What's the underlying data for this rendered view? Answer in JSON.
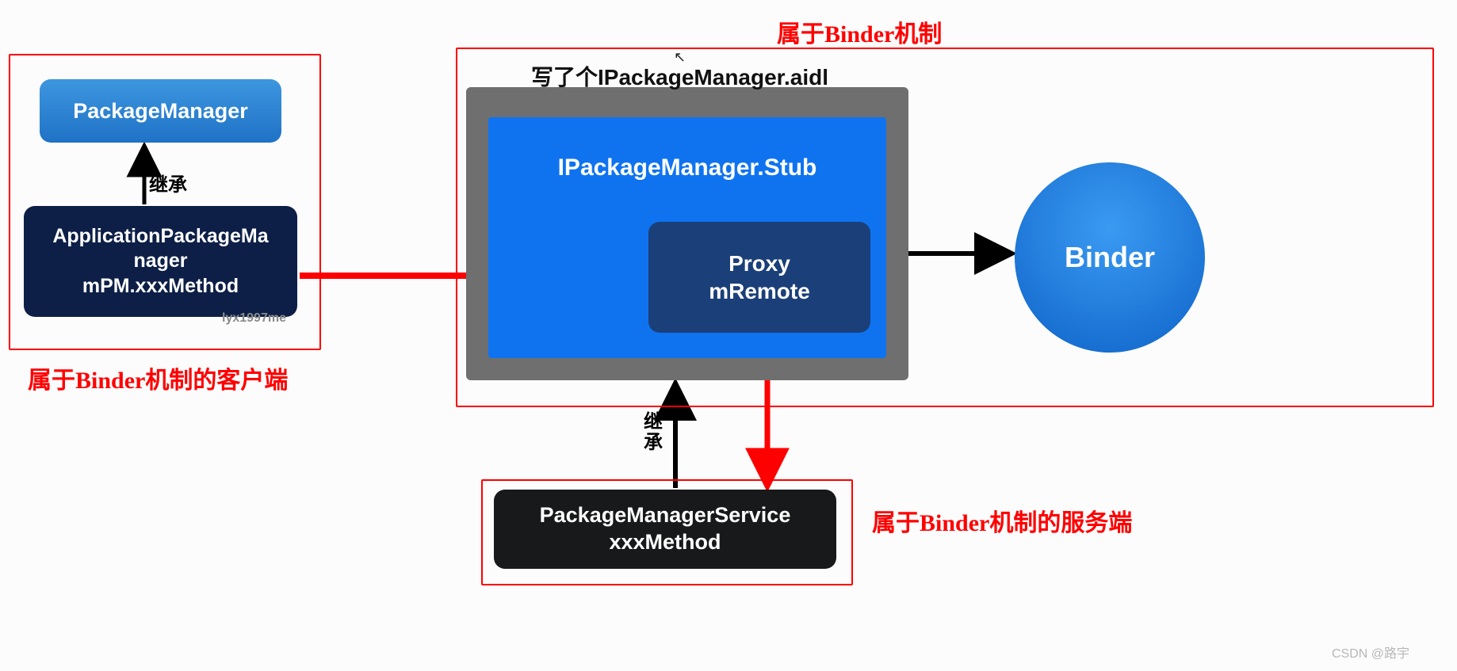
{
  "labels": {
    "binder_top": "属于Binder机制",
    "client": "属于Binder机制的客户端",
    "server": "属于Binder机制的服务端",
    "aidl_file": "写了个IPackageManager.aidl",
    "inherit1": "继承",
    "inherit2_a": "继",
    "inherit2_b": "承"
  },
  "boxes": {
    "package_manager": "PackageManager",
    "apm_line1": "ApplicationPackageMa",
    "apm_line2": "nager",
    "apm_line3": "mPM.xxxMethod",
    "stub": "IPackageManager.Stub",
    "proxy_line1": "Proxy",
    "proxy_line2": "mRemote",
    "binder": "Binder",
    "pms_line1": "PackageManagerService",
    "pms_line2": "xxxMethod"
  },
  "watermark": "lyx1997me",
  "footer": "CSDN @路宇",
  "cursor_glyph": "↖",
  "chart_data": {
    "type": "diagram",
    "nodes": [
      {
        "id": "PackageManager",
        "group": "client"
      },
      {
        "id": "ApplicationPackageManager mPM.xxxMethod",
        "group": "client"
      },
      {
        "id": "IPackageManager.aidl",
        "group": "binder",
        "container": true
      },
      {
        "id": "IPackageManager.Stub",
        "group": "binder",
        "parent": "IPackageManager.aidl"
      },
      {
        "id": "Proxy mRemote",
        "group": "binder",
        "parent": "IPackageManager.Stub"
      },
      {
        "id": "Binder",
        "group": "binder"
      },
      {
        "id": "PackageManagerService xxxMethod",
        "group": "server"
      }
    ],
    "edges": [
      {
        "from": "ApplicationPackageManager mPM.xxxMethod",
        "to": "PackageManager",
        "label": "继承",
        "color": "black"
      },
      {
        "from": "ApplicationPackageManager mPM.xxxMethod",
        "to": "Proxy mRemote",
        "color": "red"
      },
      {
        "from": "Proxy mRemote",
        "to": "Binder",
        "color": "black"
      },
      {
        "from": "PackageManagerService xxxMethod",
        "to": "IPackageManager.Stub",
        "label": "继承",
        "color": "black"
      },
      {
        "from": "Proxy mRemote",
        "to": "PackageManagerService xxxMethod",
        "color": "red"
      }
    ],
    "annotations": [
      {
        "text": "属于Binder机制",
        "target": "binder-group"
      },
      {
        "text": "属于Binder机制的客户端",
        "target": "client-group"
      },
      {
        "text": "属于Binder机制的服务端",
        "target": "server-group"
      }
    ]
  }
}
